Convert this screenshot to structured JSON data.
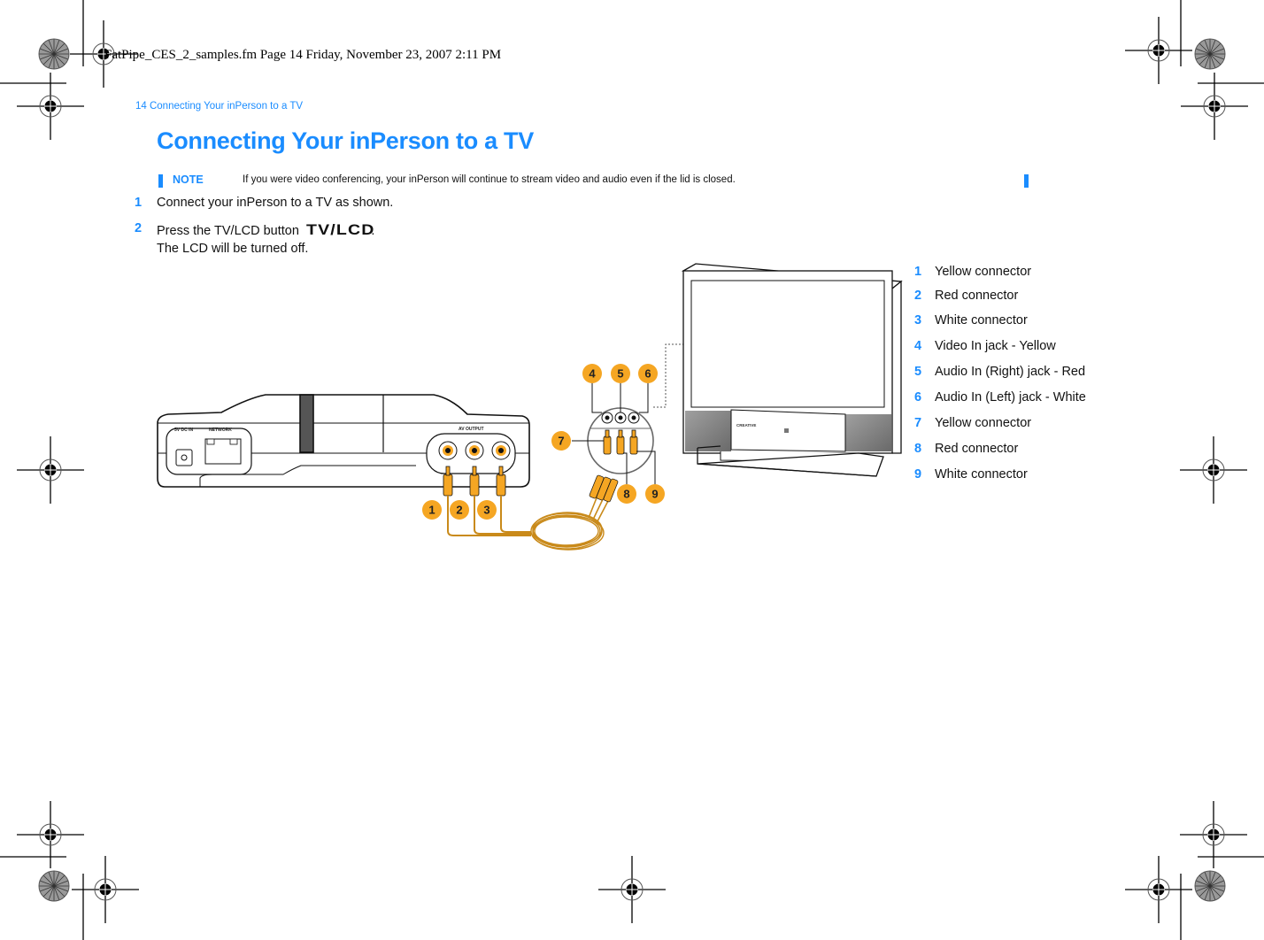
{
  "print_header": "FatPipe_CES_2_samples.fm  Page 14  Friday, November 23, 2007  2:11 PM",
  "running_head": "14  Connecting Your inPerson to a TV",
  "title": "Connecting Your inPerson to a TV",
  "note": {
    "label": "NOTE",
    "text": "If you were video conferencing, your inPerson will continue to stream video and audio even if the lid is closed."
  },
  "steps": [
    {
      "num": "1",
      "text": "Connect your inPerson to a TV as shown."
    },
    {
      "num": "2",
      "text_before": "Press the TV/LCD button",
      "button_glyph": "TV/LCD",
      "text_after": ".",
      "text_line2": "The LCD will be turned off."
    }
  ],
  "legend": [
    {
      "num": "1",
      "text": "Yellow connector"
    },
    {
      "num": "2",
      "text": "Red connector"
    },
    {
      "num": "3",
      "text": "White connector"
    },
    {
      "num": "4",
      "text": "Video In jack - Yellow"
    },
    {
      "num": "5",
      "text": "Audio In (Right) jack - Red"
    },
    {
      "num": "6",
      "text": "Audio In (Left) jack - White"
    },
    {
      "num": "7",
      "text": "Yellow connector"
    },
    {
      "num": "8",
      "text": "Red connector"
    },
    {
      "num": "9",
      "text": "White connector"
    }
  ],
  "diagram": {
    "device_labels": {
      "power": "5V DC IN",
      "network": "NETWORK",
      "av_output": "AV OUTPUT"
    },
    "tv_brand": "CREATIVE",
    "callouts": [
      "1",
      "2",
      "3",
      "4",
      "5",
      "6",
      "7",
      "8",
      "9"
    ]
  },
  "colors": {
    "accent_blue": "#1a8cff",
    "connector_orange": "#f5a623",
    "text": "#111111"
  }
}
